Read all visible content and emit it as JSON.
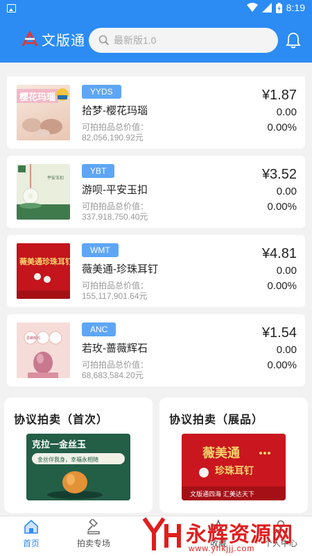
{
  "status_bar": {
    "time": "8:19"
  },
  "header": {
    "logo_text": "文版通",
    "search_placeholder": "最新版1.0"
  },
  "products": [
    {
      "code": "YYDS",
      "name": "拾梦-樱花玛瑙",
      "value_label": "可拍拍品总价值：",
      "value": "82,056,190.92元",
      "price": "¥1.87",
      "change": "0.00",
      "percent": "0.00%",
      "thumb_text": "樱花玛瑙"
    },
    {
      "code": "YBT",
      "name": "游呗-平安玉扣",
      "value_label": "可拍拍品总价值：",
      "value": "337,918,750.40元",
      "price": "¥3.52",
      "change": "0.00",
      "percent": "0.00%",
      "thumb_text": "平安玉扣"
    },
    {
      "code": "WMT",
      "name": "薇美通-珍珠耳钉",
      "value_label": "可拍拍品总价值：",
      "value": "155,117,901.64元",
      "price": "¥4.81",
      "change": "0.00",
      "percent": "0.00%",
      "thumb_text": "薇美通珍珠耳钉"
    },
    {
      "code": "ANC",
      "name": "若玫-蔷薇辉石",
      "value_label": "可拍拍品总价值：",
      "value": "68,683,584.20元",
      "price": "¥1.54",
      "change": "0.00",
      "percent": "0.00%",
      "thumb_text": "蔷薇辉石"
    }
  ],
  "promos": [
    {
      "title": "协议拍卖（首次）",
      "banner_title": "克拉一金丝玉",
      "banner_sub": "金丝伴我身，幸福永相随"
    },
    {
      "title": "协议拍卖（展品）",
      "banner_title": "薇美通",
      "banner_sub": "珍珠耳钉",
      "banner_foot": "文版通四海 汇美达天下"
    }
  ],
  "tabbar": {
    "tabs": [
      {
        "label": "首页"
      },
      {
        "label": "拍卖专场"
      },
      {
        "label": "收藏"
      },
      {
        "label": "个人中心"
      }
    ]
  },
  "watermark": {
    "text": "永辉资源网",
    "url": "www.yhkjjj.com"
  },
  "colors": {
    "primary": "#2c8cf4",
    "badge": "#5ea6f5",
    "watermark": "#e01e1e"
  }
}
